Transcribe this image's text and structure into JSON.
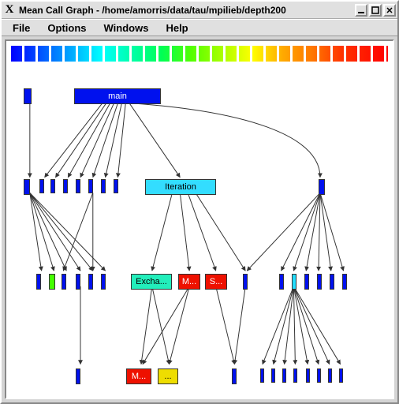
{
  "window": {
    "title": "Mean Call Graph - /home/amorris/data/tau/mpilieb/depth200"
  },
  "menubar": {
    "items": [
      "File",
      "Options",
      "Windows",
      "Help"
    ]
  },
  "nodes": {
    "main": {
      "label": "main"
    },
    "iteration": {
      "label": "Iteration"
    },
    "excha": {
      "label": "Excha..."
    },
    "m1": {
      "label": "M..."
    },
    "s1": {
      "label": "S..."
    },
    "m2": {
      "label": "M..."
    },
    "y1": {
      "label": "..."
    }
  },
  "chart_data": {
    "type": "diagram",
    "title": "Mean Call Graph - /home/amorris/data/tau/mpilieb/depth200",
    "nodes": [
      {
        "id": "root_tick",
        "label": ".",
        "color": "#0011ee",
        "level": 0
      },
      {
        "id": "main",
        "label": "main",
        "color": "#0011ee",
        "level": 0
      },
      {
        "id": "l1_a",
        "label": "",
        "color": "#0011ee",
        "level": 1
      },
      {
        "id": "l1_b1",
        "label": "",
        "color": "#0011ee",
        "level": 1
      },
      {
        "id": "l1_b2",
        "label": "",
        "color": "#0011ee",
        "level": 1
      },
      {
        "id": "l1_b3",
        "label": "",
        "color": "#0011ee",
        "level": 1
      },
      {
        "id": "l1_b4",
        "label": "",
        "color": "#0011ee",
        "level": 1
      },
      {
        "id": "l1_b5",
        "label": "",
        "color": "#0011ee",
        "level": 1
      },
      {
        "id": "l1_b6",
        "label": "",
        "color": "#0011ee",
        "level": 1
      },
      {
        "id": "l1_b7",
        "label": "",
        "color": "#0011ee",
        "level": 1
      },
      {
        "id": "iteration",
        "label": "Iteration",
        "color": "#33ddff",
        "level": 1
      },
      {
        "id": "l1_r",
        "label": "",
        "color": "#0011ee",
        "level": 1
      },
      {
        "id": "l2_a1",
        "label": "",
        "color": "#0011ee",
        "level": 2
      },
      {
        "id": "l2_a2",
        "label": "",
        "color": "#44ff00",
        "level": 2
      },
      {
        "id": "l2_a3",
        "label": "",
        "color": "#0011ee",
        "level": 2
      },
      {
        "id": "l2_a4",
        "label": "",
        "color": "#0011ee",
        "level": 2
      },
      {
        "id": "l2_a5",
        "label": "",
        "color": "#0011ee",
        "level": 2
      },
      {
        "id": "l2_a6",
        "label": "",
        "color": "#0011ee",
        "level": 2
      },
      {
        "id": "excha",
        "label": "Excha...",
        "color": "#22eebb",
        "level": 2
      },
      {
        "id": "m1",
        "label": "M...",
        "color": "#ee1100",
        "level": 2
      },
      {
        "id": "s1",
        "label": "S...",
        "color": "#ee1100",
        "level": 2
      },
      {
        "id": "l2_mid",
        "label": "",
        "color": "#0011ee",
        "level": 2
      },
      {
        "id": "l2_r1",
        "label": "",
        "color": "#0011ee",
        "level": 2
      },
      {
        "id": "l2_r2",
        "label": "",
        "color": "#22ddff",
        "level": 2
      },
      {
        "id": "l2_r3",
        "label": "",
        "color": "#0011ee",
        "level": 2
      },
      {
        "id": "l2_r4",
        "label": "",
        "color": "#0011ee",
        "level": 2
      },
      {
        "id": "l2_r5",
        "label": "",
        "color": "#0011ee",
        "level": 2
      },
      {
        "id": "l2_r6",
        "label": "",
        "color": "#0011ee",
        "level": 2
      },
      {
        "id": "l3_left",
        "label": "",
        "color": "#0011ee",
        "level": 3
      },
      {
        "id": "m2",
        "label": "M...",
        "color": "#ee1100",
        "level": 3
      },
      {
        "id": "y1",
        "label": "...",
        "color": "#eedd00",
        "level": 3
      },
      {
        "id": "l3_mid",
        "label": "",
        "color": "#0011ee",
        "level": 3
      },
      {
        "id": "l3_r1",
        "label": "",
        "color": "#0011ee",
        "level": 3
      },
      {
        "id": "l3_r2",
        "label": "",
        "color": "#0011ee",
        "level": 3
      },
      {
        "id": "l3_r3",
        "label": "",
        "color": "#0011ee",
        "level": 3
      },
      {
        "id": "l3_r4",
        "label": "",
        "color": "#0011ee",
        "level": 3
      },
      {
        "id": "l3_r5",
        "label": "",
        "color": "#0011ee",
        "level": 3
      },
      {
        "id": "l3_r6",
        "label": "",
        "color": "#0011ee",
        "level": 3
      },
      {
        "id": "l3_r7",
        "label": "",
        "color": "#0011ee",
        "level": 3
      },
      {
        "id": "l3_r8",
        "label": "",
        "color": "#0011ee",
        "level": 3
      }
    ],
    "edges": [
      [
        "root_tick",
        "l1_a"
      ],
      [
        "main",
        "l1_b1"
      ],
      [
        "main",
        "l1_b2"
      ],
      [
        "main",
        "l1_b3"
      ],
      [
        "main",
        "l1_b4"
      ],
      [
        "main",
        "l1_b5"
      ],
      [
        "main",
        "l1_b6"
      ],
      [
        "main",
        "l1_b7"
      ],
      [
        "main",
        "iteration"
      ],
      [
        "main",
        "l1_r"
      ],
      [
        "l1_a",
        "l2_a1"
      ],
      [
        "l1_a",
        "l2_a2"
      ],
      [
        "l1_a",
        "l2_a3"
      ],
      [
        "l1_a",
        "l2_a4"
      ],
      [
        "l1_a",
        "l2_a5"
      ],
      [
        "l1_a",
        "l2_a6"
      ],
      [
        "l1_b5",
        "l2_a5"
      ],
      [
        "iteration",
        "excha"
      ],
      [
        "iteration",
        "m1"
      ],
      [
        "iteration",
        "s1"
      ],
      [
        "iteration",
        "l2_mid"
      ],
      [
        "l1_r",
        "l2_mid"
      ],
      [
        "l1_r",
        "l2_r1"
      ],
      [
        "l1_r",
        "l2_r2"
      ],
      [
        "l1_r",
        "l2_r3"
      ],
      [
        "l1_r",
        "l2_r4"
      ],
      [
        "l1_r",
        "l2_r5"
      ],
      [
        "l1_r",
        "l2_r6"
      ],
      [
        "l2_a4",
        "l3_left"
      ],
      [
        "excha",
        "m2"
      ],
      [
        "excha",
        "y1"
      ],
      [
        "m1",
        "m2"
      ],
      [
        "m1",
        "y1"
      ],
      [
        "s1",
        "l3_mid"
      ],
      [
        "l2_mid",
        "l3_mid"
      ],
      [
        "l2_r2",
        "l3_r1"
      ],
      [
        "l2_r2",
        "l3_r2"
      ],
      [
        "l2_r2",
        "l3_r3"
      ],
      [
        "l2_r2",
        "l3_r4"
      ],
      [
        "l2_r2",
        "l3_r5"
      ],
      [
        "l2_r2",
        "l3_r6"
      ],
      [
        "l2_r2",
        "l3_r7"
      ],
      [
        "l2_r2",
        "l3_r8"
      ]
    ]
  }
}
